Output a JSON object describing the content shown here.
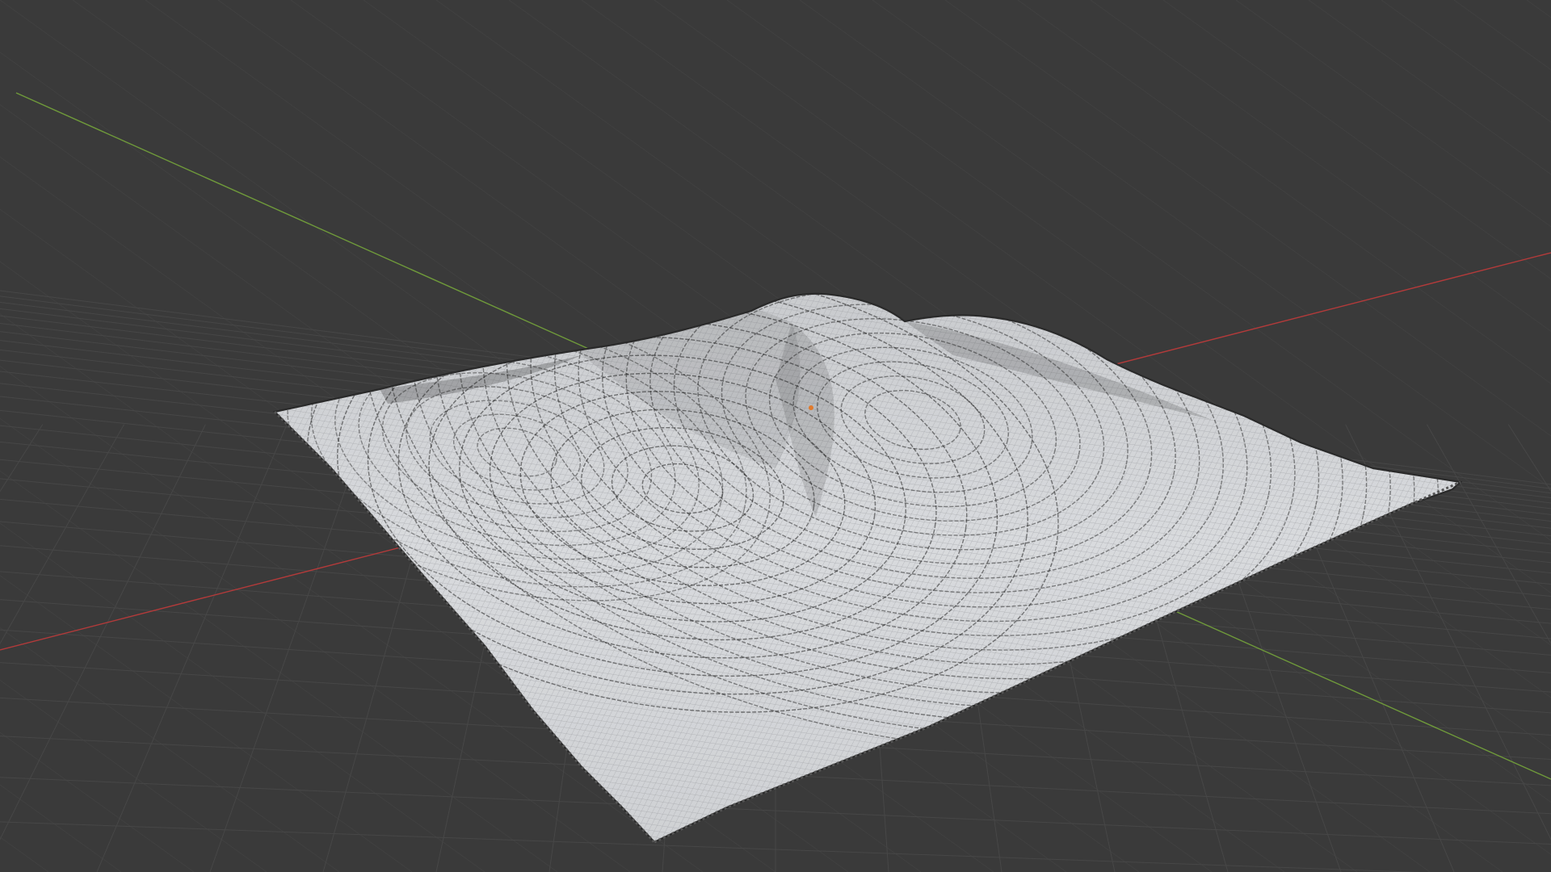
{
  "app": {
    "name": "3D viewport"
  },
  "viewport": {
    "background_color": "#3a3a3a",
    "grid_color": "#474747",
    "x_axis_color": "#b33a3a",
    "y_axis_color": "#6f9a3a",
    "grid_visible": true
  },
  "object": {
    "type": "terrain-mesh",
    "display_mode": "wireframe-over-solid",
    "surface_color": "#d7d9dc",
    "wire_color": "#1f1f1f",
    "origin_marker_color": "#e07a2c"
  }
}
